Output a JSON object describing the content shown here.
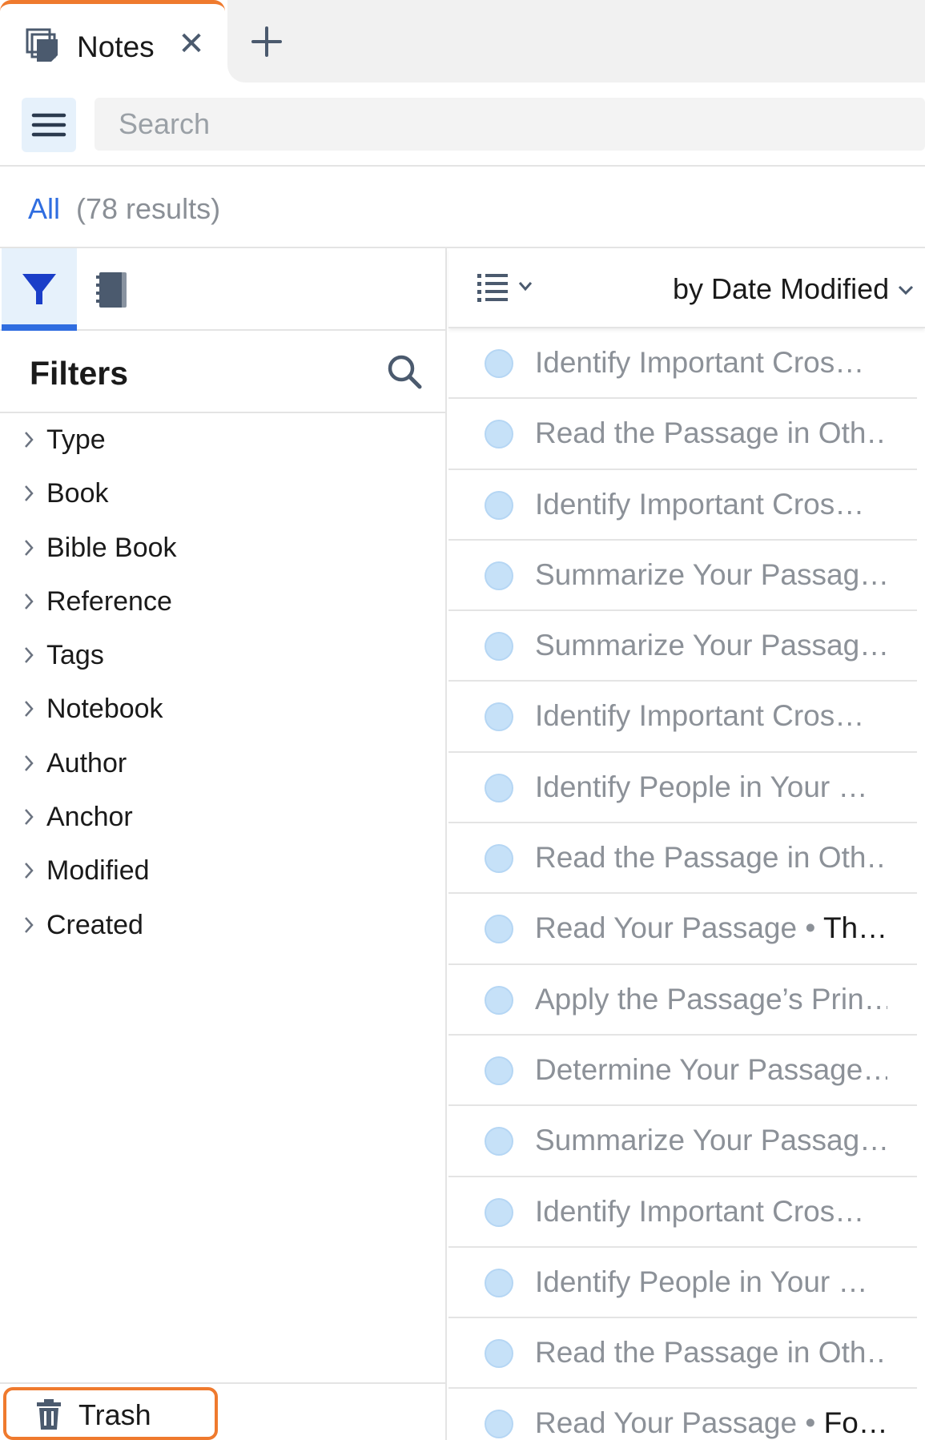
{
  "tab": {
    "label": "Notes",
    "close_glyph": "✕",
    "new_glyph": "+"
  },
  "search": {
    "placeholder": "Search",
    "value": ""
  },
  "results": {
    "filter": "All",
    "count": "(78 results)"
  },
  "filters": {
    "title": "Filters",
    "items": [
      "Type",
      "Book",
      "Bible Book",
      "Reference",
      "Tags",
      "Notebook",
      "Author",
      "Anchor",
      "Modified",
      "Created"
    ]
  },
  "trash": {
    "label": "Trash"
  },
  "sort": {
    "label": "by Date Modified"
  },
  "notes": [
    {
      "title": "Identify Important Cros…"
    },
    {
      "title": "Read the Passage in Oth…"
    },
    {
      "title": "Identify Important Cros…"
    },
    {
      "title": "Summarize Your Passag…"
    },
    {
      "title": "Summarize Your Passag…"
    },
    {
      "title": "Identify Important Cros…"
    },
    {
      "title": "Identify People in Your …"
    },
    {
      "title": "Read the Passage in Oth…"
    },
    {
      "title": "Read Your Passage",
      "sep": " • ",
      "extra": "Th…"
    },
    {
      "title": "Apply the Passage’s Prin…"
    },
    {
      "title": "Determine Your Passage…"
    },
    {
      "title": "Summarize Your Passag…"
    },
    {
      "title": "Identify Important Cros…"
    },
    {
      "title": "Identify People in Your …"
    },
    {
      "title": "Read the Passage in Oth…"
    },
    {
      "title": "Read Your Passage",
      "sep": " • ",
      "extra": "Fo…"
    }
  ],
  "colors": {
    "accent": "#2f6de0",
    "highlight": "#ef7a2e",
    "dot": "#c6e1f8",
    "icon": "#4b5a6e"
  }
}
